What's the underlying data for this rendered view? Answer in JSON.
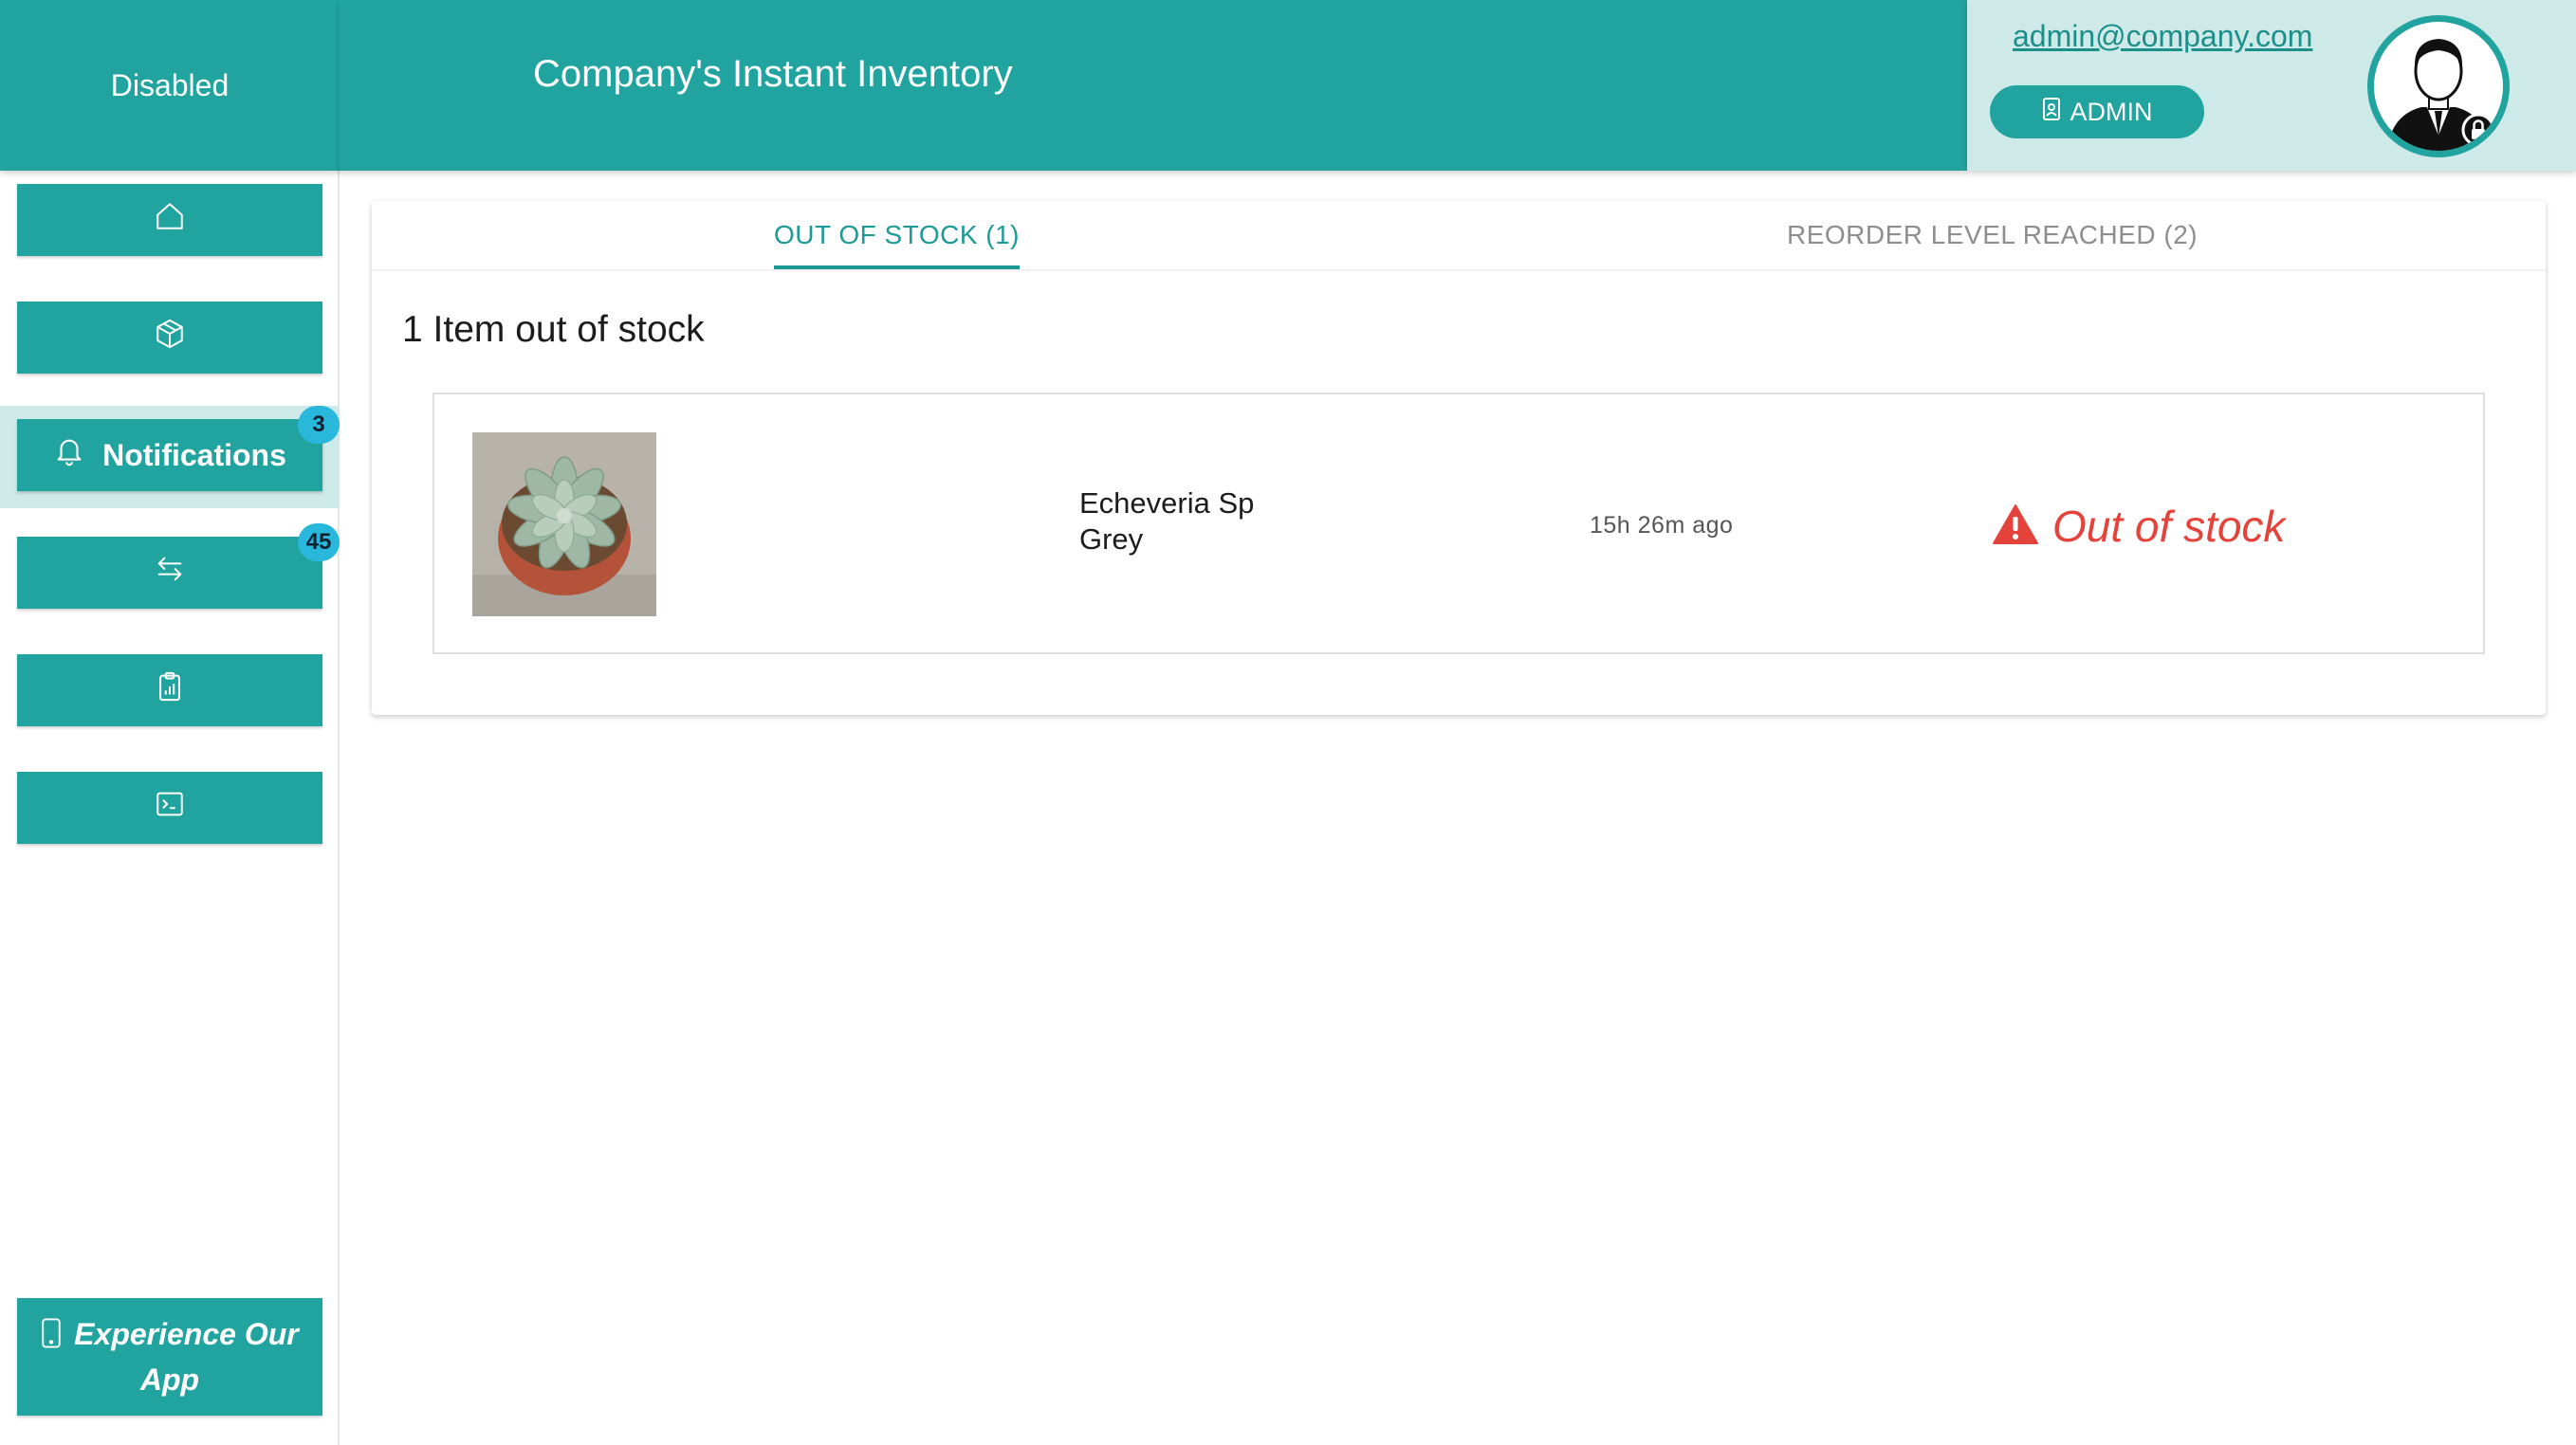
{
  "sidebar": {
    "status_label": "Disabled",
    "items": [
      {
        "icon": "home-icon",
        "label": "",
        "badge": ""
      },
      {
        "icon": "box-icon",
        "label": "",
        "badge": ""
      },
      {
        "icon": "bell-icon",
        "label": "Notifications",
        "badge": "3",
        "active": true
      },
      {
        "icon": "transfer-arrows-icon",
        "label": "",
        "badge": "45"
      },
      {
        "icon": "clipboard-chart-icon",
        "label": "",
        "badge": ""
      },
      {
        "icon": "terminal-icon",
        "label": "",
        "badge": ""
      }
    ],
    "app_button": {
      "icon": "mobile-phone-icon",
      "label": "Experience Our App"
    }
  },
  "header": {
    "title": "Company's Instant Inventory"
  },
  "user": {
    "email": "admin@company.com",
    "role": "ADMIN",
    "avatar_icon": "admin-avatar-icon"
  },
  "tabs": [
    {
      "label": "OUT OF STOCK (1)",
      "active": true
    },
    {
      "label": "REORDER LEVEL REACHED (2)",
      "active": false
    }
  ],
  "section_title": "1 Item out of stock",
  "items": [
    {
      "name_line1": "Echeveria Sp",
      "name_line2": "Grey",
      "time": "15h 26m ago",
      "status": "Out of stock",
      "status_icon": "warning-triangle-icon"
    }
  ],
  "colors": {
    "primary": "#21a39f",
    "active_bg": "#cde9e8",
    "badge": "#29b7dc",
    "alert": "#e4433b"
  }
}
